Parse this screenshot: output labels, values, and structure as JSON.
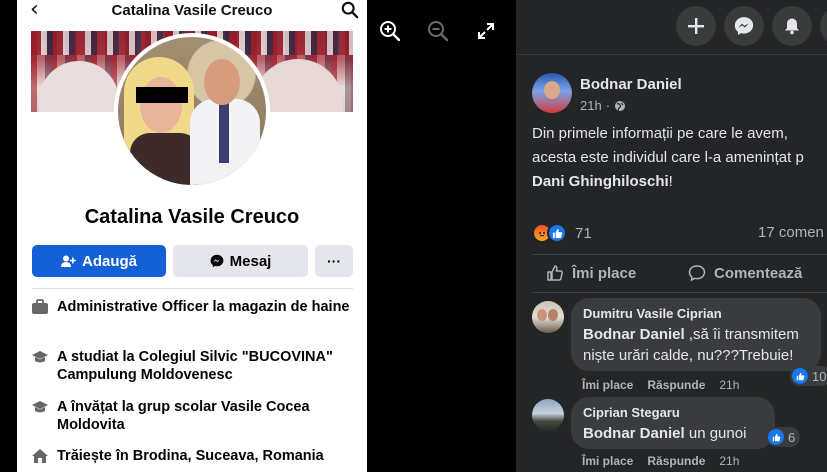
{
  "profile": {
    "title": "Catalina Vasile Creuco",
    "name": "Catalina Vasile Creuco",
    "buttons": {
      "add": "Adaugă",
      "message": "Mesaj",
      "more": "···"
    },
    "info": [
      {
        "icon": "briefcase-icon",
        "text": "Administrative Officer la magazin de haine"
      },
      {
        "icon": "graduation-cap-icon",
        "prefix": "A studiat la ",
        "name": "Colegiul Silvic \"BUCOVINA\" Campulung Moldovenesc"
      },
      {
        "icon": "graduation-cap-icon",
        "text": "A învățat la grup scolar Vasile Cocea Moldovita"
      },
      {
        "icon": "home-icon",
        "prefix": "Trăiește în ",
        "name": "Brodina, Suceava, Romania"
      }
    ]
  },
  "viewer": {
    "controls": [
      "zoom-in-icon",
      "zoom-out-icon",
      "fullscreen-icon"
    ]
  },
  "post": {
    "author": "Bodnar Daniel",
    "time": "21h",
    "text_line1": "Din primele informații pe care le avem,",
    "text_line2": "acesta este individul care l-a amenințat p",
    "text_name": "Dani Ghinghiloschi",
    "text_end": "!",
    "reactions_count": "71",
    "comments_count": "17 comen",
    "actions": {
      "like": "Îmi place",
      "comment": "Comentează"
    }
  },
  "comments": [
    {
      "name": "Dumitru Vasile Ciprian",
      "mention": "Bodnar Daniel",
      "line1": " ,să îi transmitem",
      "line2": "niște urări calde, nu???Trebuie!",
      "like": "Îmi place",
      "reply": "Răspunde",
      "time": "21h",
      "reactions": "10"
    },
    {
      "name": "Ciprian Stegaru",
      "mention": "Bodnar Daniel",
      "line1": " un gunoi",
      "like": "Îmi place",
      "reply": "Răspunde",
      "time": "21h",
      "reactions": "6"
    }
  ],
  "colors": {
    "brand_blue": "#1460d6",
    "dark_panel": "#242526",
    "bubble": "#3a3b3c",
    "text_dark_primary": "#e4e6eb",
    "text_dark_secondary": "#b0b3b8"
  }
}
